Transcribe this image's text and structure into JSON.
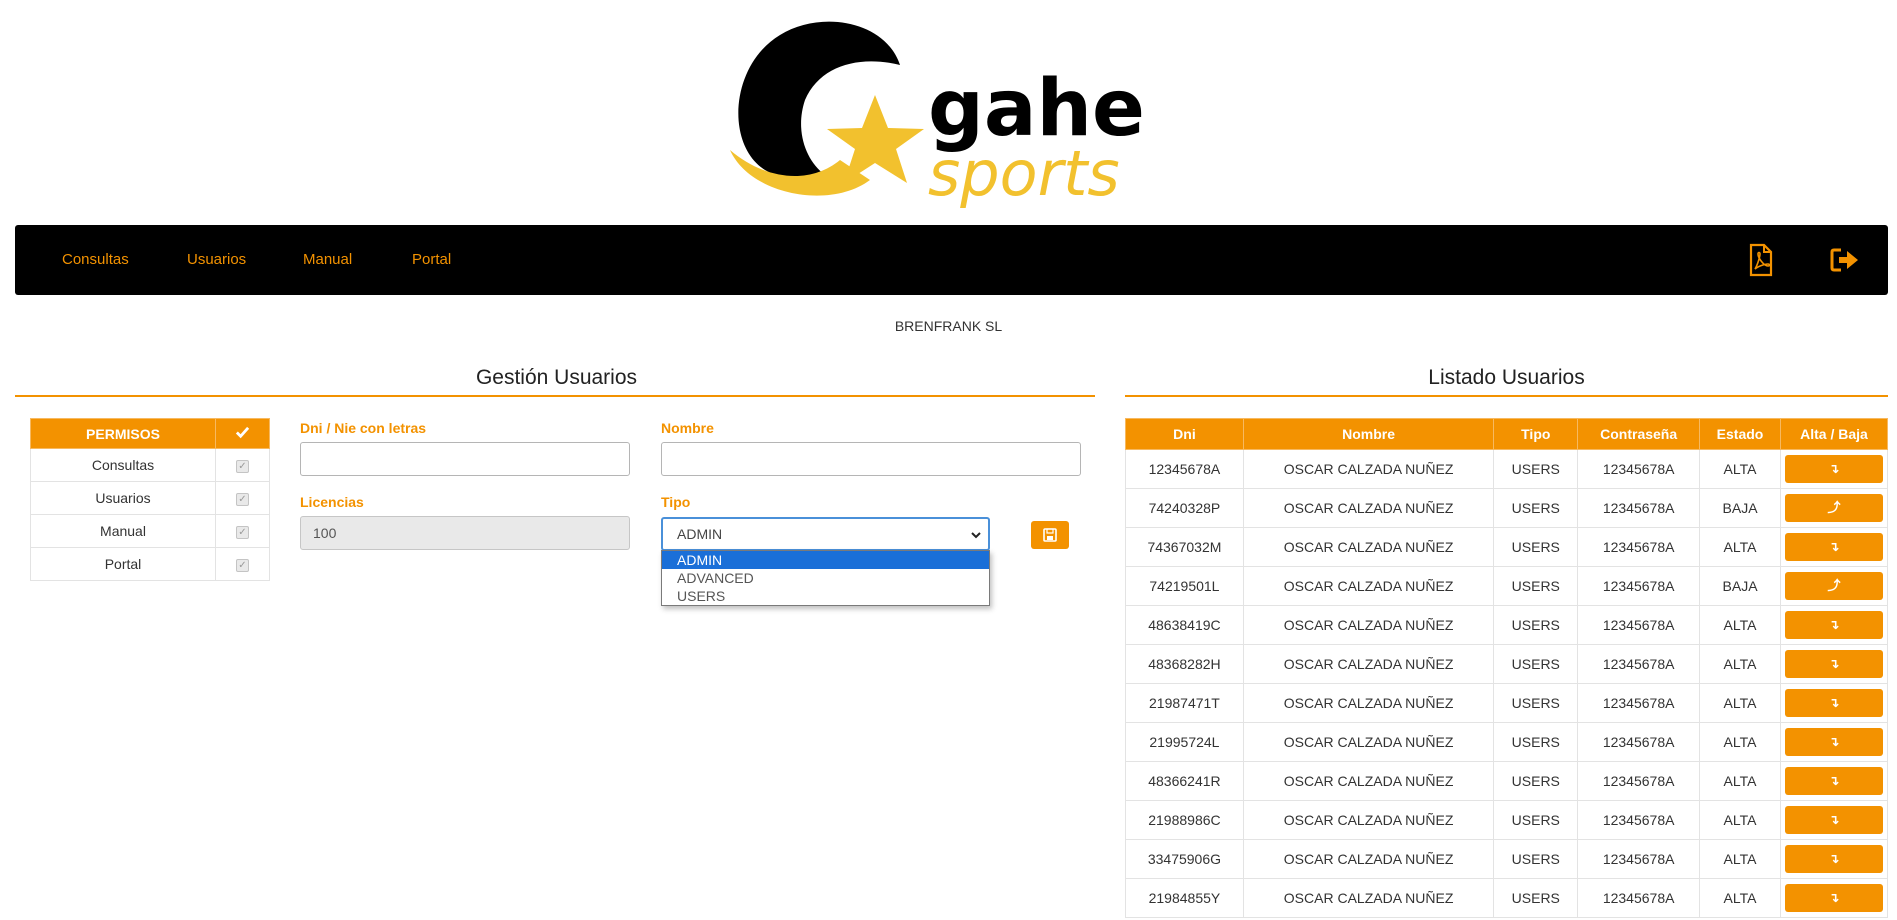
{
  "brand": {
    "logo_line1": "gahe",
    "logo_line2": "sports",
    "primary_color": "#f39200",
    "secondary_color": "#f2c12e",
    "dark_color": "#000000"
  },
  "nav": {
    "items": [
      {
        "label": "Consultas"
      },
      {
        "label": "Usuarios"
      },
      {
        "label": "Manual"
      },
      {
        "label": "Portal"
      }
    ],
    "icons": [
      "pdf-icon",
      "logout-icon"
    ]
  },
  "company": "BRENFRANK SL",
  "gestion": {
    "title": "Gestión Usuarios",
    "permisos_header": "PERMISOS",
    "permisos_check_icon": "check-icon",
    "permisos": [
      {
        "label": "Consultas",
        "checked": true
      },
      {
        "label": "Usuarios",
        "checked": true
      },
      {
        "label": "Manual",
        "checked": true
      },
      {
        "label": "Portal",
        "checked": true
      }
    ],
    "fields": {
      "dni_label": "Dni / Nie con letras",
      "dni_value": "",
      "nombre_label": "Nombre",
      "nombre_value": "",
      "licencias_label": "Licencias",
      "licencias_value": "100",
      "tipo_label": "Tipo",
      "tipo_value": "ADMIN",
      "tipo_options": [
        "ADMIN",
        "ADVANCED",
        "USERS"
      ]
    },
    "save_icon": "save-icon"
  },
  "listado": {
    "title": "Listado Usuarios",
    "headers": [
      "Dni",
      "Nombre",
      "Tipo",
      "Contraseña",
      "Estado",
      "Alta / Baja"
    ],
    "rows": [
      {
        "dni": "12345678A",
        "nombre": "OSCAR CALZADA NUÑEZ",
        "tipo": "USERS",
        "pass": "12345678A",
        "estado": "ALTA",
        "action": "↴"
      },
      {
        "dni": "74240328P",
        "nombre": "OSCAR CALZADA NUÑEZ",
        "tipo": "USERS",
        "pass": "12345678A",
        "estado": "BAJA",
        "action": "⤴"
      },
      {
        "dni": "74367032M",
        "nombre": "OSCAR CALZADA NUÑEZ",
        "tipo": "USERS",
        "pass": "12345678A",
        "estado": "ALTA",
        "action": "↴"
      },
      {
        "dni": "74219501L",
        "nombre": "OSCAR CALZADA NUÑEZ",
        "tipo": "USERS",
        "pass": "12345678A",
        "estado": "BAJA",
        "action": "⤴"
      },
      {
        "dni": "48638419C",
        "nombre": "OSCAR CALZADA NUÑEZ",
        "tipo": "USERS",
        "pass": "12345678A",
        "estado": "ALTA",
        "action": "↴"
      },
      {
        "dni": "48368282H",
        "nombre": "OSCAR CALZADA NUÑEZ",
        "tipo": "USERS",
        "pass": "12345678A",
        "estado": "ALTA",
        "action": "↴"
      },
      {
        "dni": "21987471T",
        "nombre": "OSCAR CALZADA NUÑEZ",
        "tipo": "USERS",
        "pass": "12345678A",
        "estado": "ALTA",
        "action": "↴"
      },
      {
        "dni": "21995724L",
        "nombre": "OSCAR CALZADA NUÑEZ",
        "tipo": "USERS",
        "pass": "12345678A",
        "estado": "ALTA",
        "action": "↴"
      },
      {
        "dni": "48366241R",
        "nombre": "OSCAR CALZADA NUÑEZ",
        "tipo": "USERS",
        "pass": "12345678A",
        "estado": "ALTA",
        "action": "↴"
      },
      {
        "dni": "21988986C",
        "nombre": "OSCAR CALZADA NUÑEZ",
        "tipo": "USERS",
        "pass": "12345678A",
        "estado": "ALTA",
        "action": "↴"
      },
      {
        "dni": "33475906G",
        "nombre": "OSCAR CALZADA NUÑEZ",
        "tipo": "USERS",
        "pass": "12345678A",
        "estado": "ALTA",
        "action": "↴"
      },
      {
        "dni": "21984855Y",
        "nombre": "OSCAR CALZADA NUÑEZ",
        "tipo": "USERS",
        "pass": "12345678A",
        "estado": "ALTA",
        "action": "↴"
      }
    ]
  }
}
